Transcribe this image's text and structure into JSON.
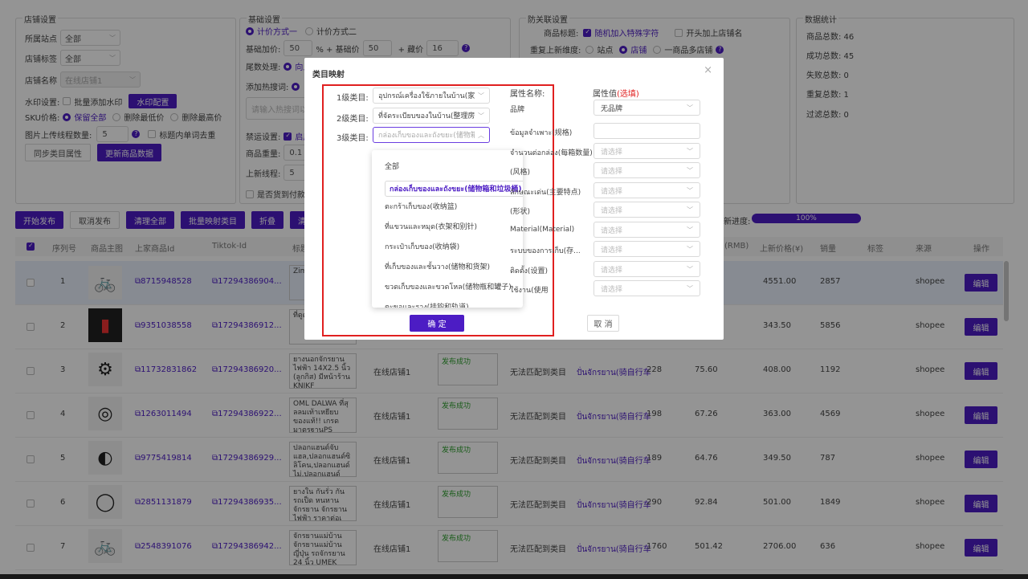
{
  "store_settings": {
    "legend": "店铺设置",
    "site_label": "所属站点",
    "site_value": "全部",
    "tag_label": "店铺标签",
    "tag_value": "全部",
    "name_label": "店铺名称",
    "name_value": "在线店铺1",
    "watermark_label": "水印设置:",
    "watermark_batch": "批量添加水印",
    "watermark_config": "水印配置",
    "sku_label": "SKU价格:",
    "sku_opt1": "保留全部",
    "sku_opt2": "删除最低价",
    "sku_opt3": "删除最高价",
    "threads_label": "图片上传线程数量:",
    "threads_value": "5",
    "dedupe_label": "标题内单词去重",
    "sync_btn": "同步类目属性",
    "update_btn": "更新商品数据"
  },
  "basic_settings": {
    "legend": "基础设置",
    "method1": "计价方式一",
    "method2": "计价方式二",
    "base_price_label": "基础加价:",
    "base_price_value": "50",
    "pct_plus": "% + 基础价",
    "base_value2": "50",
    "plus_label": "+ 藏价",
    "hidden_value": "16",
    "decimal_label": "尾数处理:",
    "decimal_opt": "向上",
    "hotword_label": "添加热搜词:",
    "hotword_placeholder": "请输入热搜词以",
    "forbid_label": "禁运设置:",
    "forbid_opt": "启用",
    "weight_label": "商品重量:",
    "weight_value": "0.1",
    "threads2_label": "上新线程:",
    "threads2_value": "5",
    "cod_label": "是否货到付款"
  },
  "anti_settings": {
    "legend": "防关联设置",
    "title_label": "商品标题:",
    "title_opt": "随机加入特殊字符",
    "title_opt2": "开头加上店铺名",
    "dup_label": "重复上新维度:",
    "dup_opt1": "站点",
    "dup_opt2": "店铺",
    "dup_opt3": "一商品多店铺"
  },
  "stats": {
    "legend": "数据统计",
    "total": "商品总数: 46",
    "success": "成功总数: 45",
    "fail": "失败总数: 0",
    "dup": "重复总数: 1",
    "filtered": "过滤总数: 0"
  },
  "actions": {
    "start": "开始发布",
    "cancel": "取消发布",
    "clear": "清理全部",
    "batch_map": "批量映射类目",
    "fold": "折叠",
    "clean": "清理",
    "progress_label": "新进度:",
    "progress_value": "100%"
  },
  "table": {
    "headers": [
      "序列号",
      "商品主图",
      "上家商品Id",
      "Tiktok-Id",
      "标题",
      "(RMB)",
      "上新价格(¥)",
      "销量",
      "标签",
      "来源",
      "操作"
    ],
    "rows": [
      {
        "idx": "1",
        "icon": "🚲",
        "src_id": "8715948528",
        "tt_id": "17294386904...",
        "title": "Zim CUD เขา",
        "store": "",
        "status": "",
        "map": "",
        "cat": "",
        "n1": "",
        "n2": "",
        "price": "4551.00",
        "sales": "2857",
        "source": "shopee"
      },
      {
        "idx": "2",
        "icon": "▮",
        "src_id": "9351038558",
        "tt_id": "17294386912...",
        "title": "ที่ดูด คม",
        "store": "",
        "status": "",
        "map": "",
        "cat": "",
        "n1": "",
        "n2": "",
        "price": "343.50",
        "sales": "5856",
        "source": "shopee"
      },
      {
        "idx": "3",
        "icon": "⚙",
        "src_id": "11732831862",
        "tt_id": "17294386920...",
        "title": "ยางนอกจักรยานไฟฟ้า 14X2.5 นิ้ว (ลูกกิส) มีหน้าร้าน KNJKF",
        "store": "在线店铺1",
        "status": "发布成功",
        "map": "无法匹配到类目",
        "cat": "ปั่นจักรยาน(骑自行车",
        "n1": "228",
        "n2": "75.60",
        "price": "408.00",
        "sales": "1192",
        "source": "shopee"
      },
      {
        "idx": "4",
        "icon": "◎",
        "src_id": "1263011494",
        "tt_id": "17294386922...",
        "title": "OML DALWA ที่สุลลมเท้าเหยียบ ของแท้!! เกรดมาตรฐานPS",
        "store": "在线店铺1",
        "status": "发布成功",
        "map": "无法匹配到类目",
        "cat": "ปั่นจักรยาน(骑自行车",
        "n1": "198",
        "n2": "67.26",
        "price": "363.00",
        "sales": "4569",
        "source": "shopee"
      },
      {
        "idx": "5",
        "icon": "◐",
        "src_id": "9775419814",
        "tt_id": "17294386929...",
        "title": "ปลอกแฮนด์จับแฮล,ปลอกแฮนด์ซิลิโคน,ปลอกแฮนด์ไม่,ปลอกแฮนด์",
        "store": "在线店铺1",
        "status": "发布成功",
        "map": "无法匹配到类目",
        "cat": "ปั่นจักรยาน(骑自行车",
        "n1": "189",
        "n2": "64.76",
        "price": "349.50",
        "sales": "787",
        "source": "shopee"
      },
      {
        "idx": "6",
        "icon": "◯",
        "src_id": "2851131879",
        "tt_id": "17294386935...",
        "title": "ยางใน กันรั่ว กันรถเป็ด หนหาน จักรยาน จักรยานไฟฟ้า ราคาต่อเ",
        "store": "在线店铺1",
        "status": "发布成功",
        "map": "无法匹配到类目",
        "cat": "ปั่นจักรยาน(骑自行车",
        "n1": "290",
        "n2": "92.84",
        "price": "501.00",
        "sales": "1849",
        "source": "shopee"
      },
      {
        "idx": "7",
        "icon": "🚲",
        "src_id": "2548391076",
        "tt_id": "17294386942...",
        "title": "จักรยานแม่บ้าน จักรยานแม่บ้านญี่ปุ่น รถจักรยาน 24 นิ้ว UMEK",
        "store": "在线店铺1",
        "status": "发布成功",
        "map": "无法匹配到类目",
        "cat": "ปั่นจักรยาน(骑自行车",
        "n1": "1760",
        "n2": "501.42",
        "price": "2706.00",
        "sales": "636",
        "source": "shopee"
      }
    ],
    "edit_label": "编辑"
  },
  "modal": {
    "title": "类目映射",
    "close": "×",
    "lvl1_label": "1级类目:",
    "lvl1_value": "อุปกรณ์เครื่องใช้ภายในบ้าน(家电器",
    "lvl2_label": "2级类目:",
    "lvl2_value": "ที่จัดระเบียบของในบ้าน(整理房子",
    "lvl3_label": "3级类目:",
    "lvl3_value": "กล่องเก็บของและถังขยะ(储物箱和",
    "dropdown": [
      "全部",
      "กล่องเก็บของและถังขยะ(储物箱和垃圾桶)",
      "ตะกร้าเก็บของ(收纳篮)",
      "ที่แขวนและหมุด(衣架和别针)",
      "กระเป๋าเก็บของ(收纳袋)",
      "ที่เก็บของและชั้นวาง(储物和货架)",
      "ขวดเก็บของและขวดโหล(储物瓶和罐子)",
      "ตะขอและราง(挂钩和轨道)"
    ],
    "attr_name_header": "属性名称:",
    "attr_value_header": "属性值",
    "attr_value_optional": "(选填)",
    "attrs": [
      {
        "name": "品牌",
        "value": "无品牌",
        "kind": "select-val"
      },
      {
        "name": "ข้อมูลจำเพาะ(规格)",
        "value": "",
        "kind": "text"
      },
      {
        "name": "จำนวนต่อกล่อง(每箱数量)",
        "value": "请选择",
        "kind": "select"
      },
      {
        "name": "(风格)",
        "value": "请选择",
        "kind": "select"
      },
      {
        "name": "ลักษณะเด่น(主要特点)",
        "value": "请选择",
        "kind": "select"
      },
      {
        "name": "(形状)",
        "value": "请选择",
        "kind": "select"
      },
      {
        "name": "Material(Material)",
        "value": "请选择",
        "kind": "select"
      },
      {
        "name": "ระบบของการเก็บ(存...",
        "value": "请选择",
        "kind": "select"
      },
      {
        "name": "ติดตั้ง(设置)",
        "value": "请选择",
        "kind": "select"
      },
      {
        "name": "ใช้งาน(使用",
        "value": "请选择",
        "kind": "select"
      }
    ],
    "ok": "确 定",
    "cancel": "取 消"
  }
}
